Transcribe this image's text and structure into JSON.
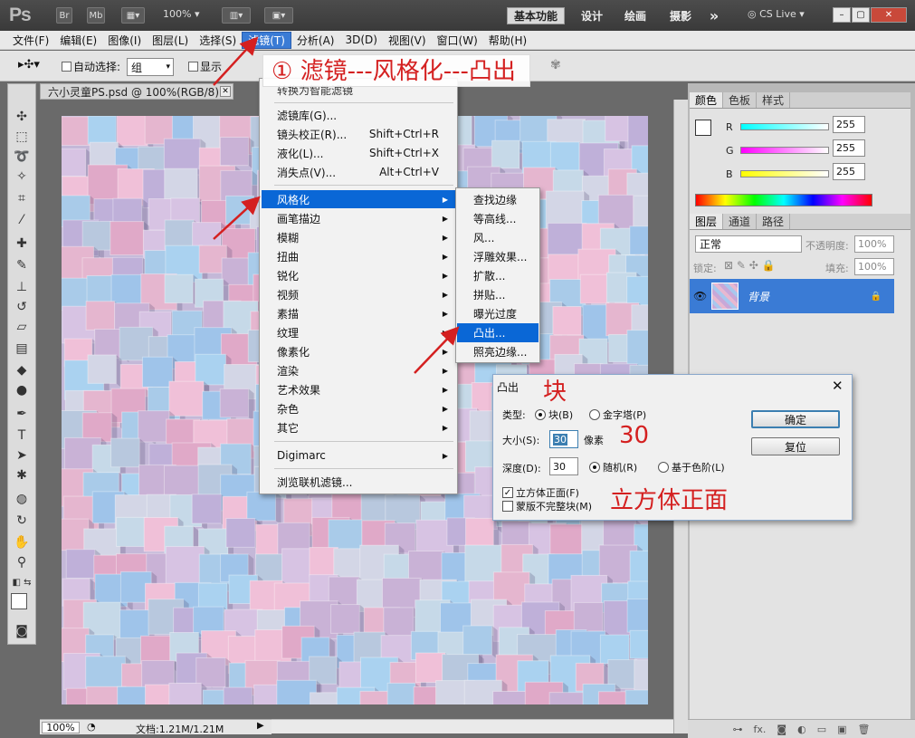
{
  "appbar": {
    "logo": "Ps",
    "btn_br": "Br",
    "btn_mb": "Mb",
    "zoom": "100% ▾",
    "workspaces": [
      "基本功能",
      "设计",
      "绘画",
      "摄影"
    ],
    "more": "»",
    "cslive": "CS Live ▾"
  },
  "menubar": {
    "items": [
      "文件(F)",
      "编辑(E)",
      "图像(I)",
      "图层(L)",
      "选择(S)",
      "滤镜(T)",
      "分析(A)",
      "3D(D)",
      "视图(V)",
      "窗口(W)",
      "帮助(H)"
    ]
  },
  "options": {
    "auto_select": "自动选择:",
    "group": "组",
    "show": "显示"
  },
  "document": {
    "tab": "六小灵童PS.psd @ 100%(RGB/8) *",
    "zoom": "100%",
    "size": "文档:1.21M/1.21M"
  },
  "filter_menu": {
    "top_item": "转换为智能滤镜",
    "items": [
      {
        "label": "滤镜库(G)...",
        "shortcut": ""
      },
      {
        "label": "镜头校正(R)...",
        "shortcut": "Shift+Ctrl+R"
      },
      {
        "label": "液化(L)...",
        "shortcut": "Shift+Ctrl+X"
      },
      {
        "label": "消失点(V)...",
        "shortcut": "Alt+Ctrl+V"
      }
    ],
    "categories": [
      "风格化",
      "画笔描边",
      "模糊",
      "扭曲",
      "锐化",
      "视频",
      "素描",
      "纹理",
      "像素化",
      "渲染",
      "艺术效果",
      "杂色",
      "其它"
    ],
    "digimarc": "Digimarc",
    "browse": "浏览联机滤镜..."
  },
  "stylize_menu": {
    "items": [
      "查找边缘",
      "等高线...",
      "风...",
      "浮雕效果...",
      "扩散...",
      "拼贴...",
      "曝光过度",
      "凸出...",
      "照亮边缘..."
    ],
    "highlighted": "凸出..."
  },
  "dialog": {
    "title": "凸出",
    "type_label": "类型:",
    "type_block": "块(B)",
    "type_pyramid": "金字塔(P)",
    "size_label": "大小(S):",
    "size_value": "30",
    "size_unit": "像素",
    "depth_label": "深度(D):",
    "depth_value": "30",
    "depth_random": "随机(R)",
    "depth_level": "基于色阶(L)",
    "solid_front": "立方体正面(F)",
    "mask_incomplete": "蒙版不完整块(M)",
    "ok": "确定",
    "reset": "复位"
  },
  "color_panel": {
    "tabs": [
      "颜色",
      "色板",
      "样式"
    ],
    "r_label": "R",
    "g_label": "G",
    "b_label": "B",
    "r": "255",
    "g": "255",
    "b": "255"
  },
  "layers_panel": {
    "tabs": [
      "图层",
      "通道",
      "路径"
    ],
    "blend": "正常",
    "opacity_label": "不透明度:",
    "opacity": "100%",
    "lock_label": "锁定:",
    "fill_label": "填充:",
    "fill": "100%",
    "layer_name": "背景"
  },
  "annotations": {
    "step1": "① 滤镜---风格化---凸出",
    "block": "块",
    "size30": "30",
    "cube": "立方体正面"
  },
  "colors": {
    "accent": "#0a67d6",
    "annotation": "#d42020"
  }
}
